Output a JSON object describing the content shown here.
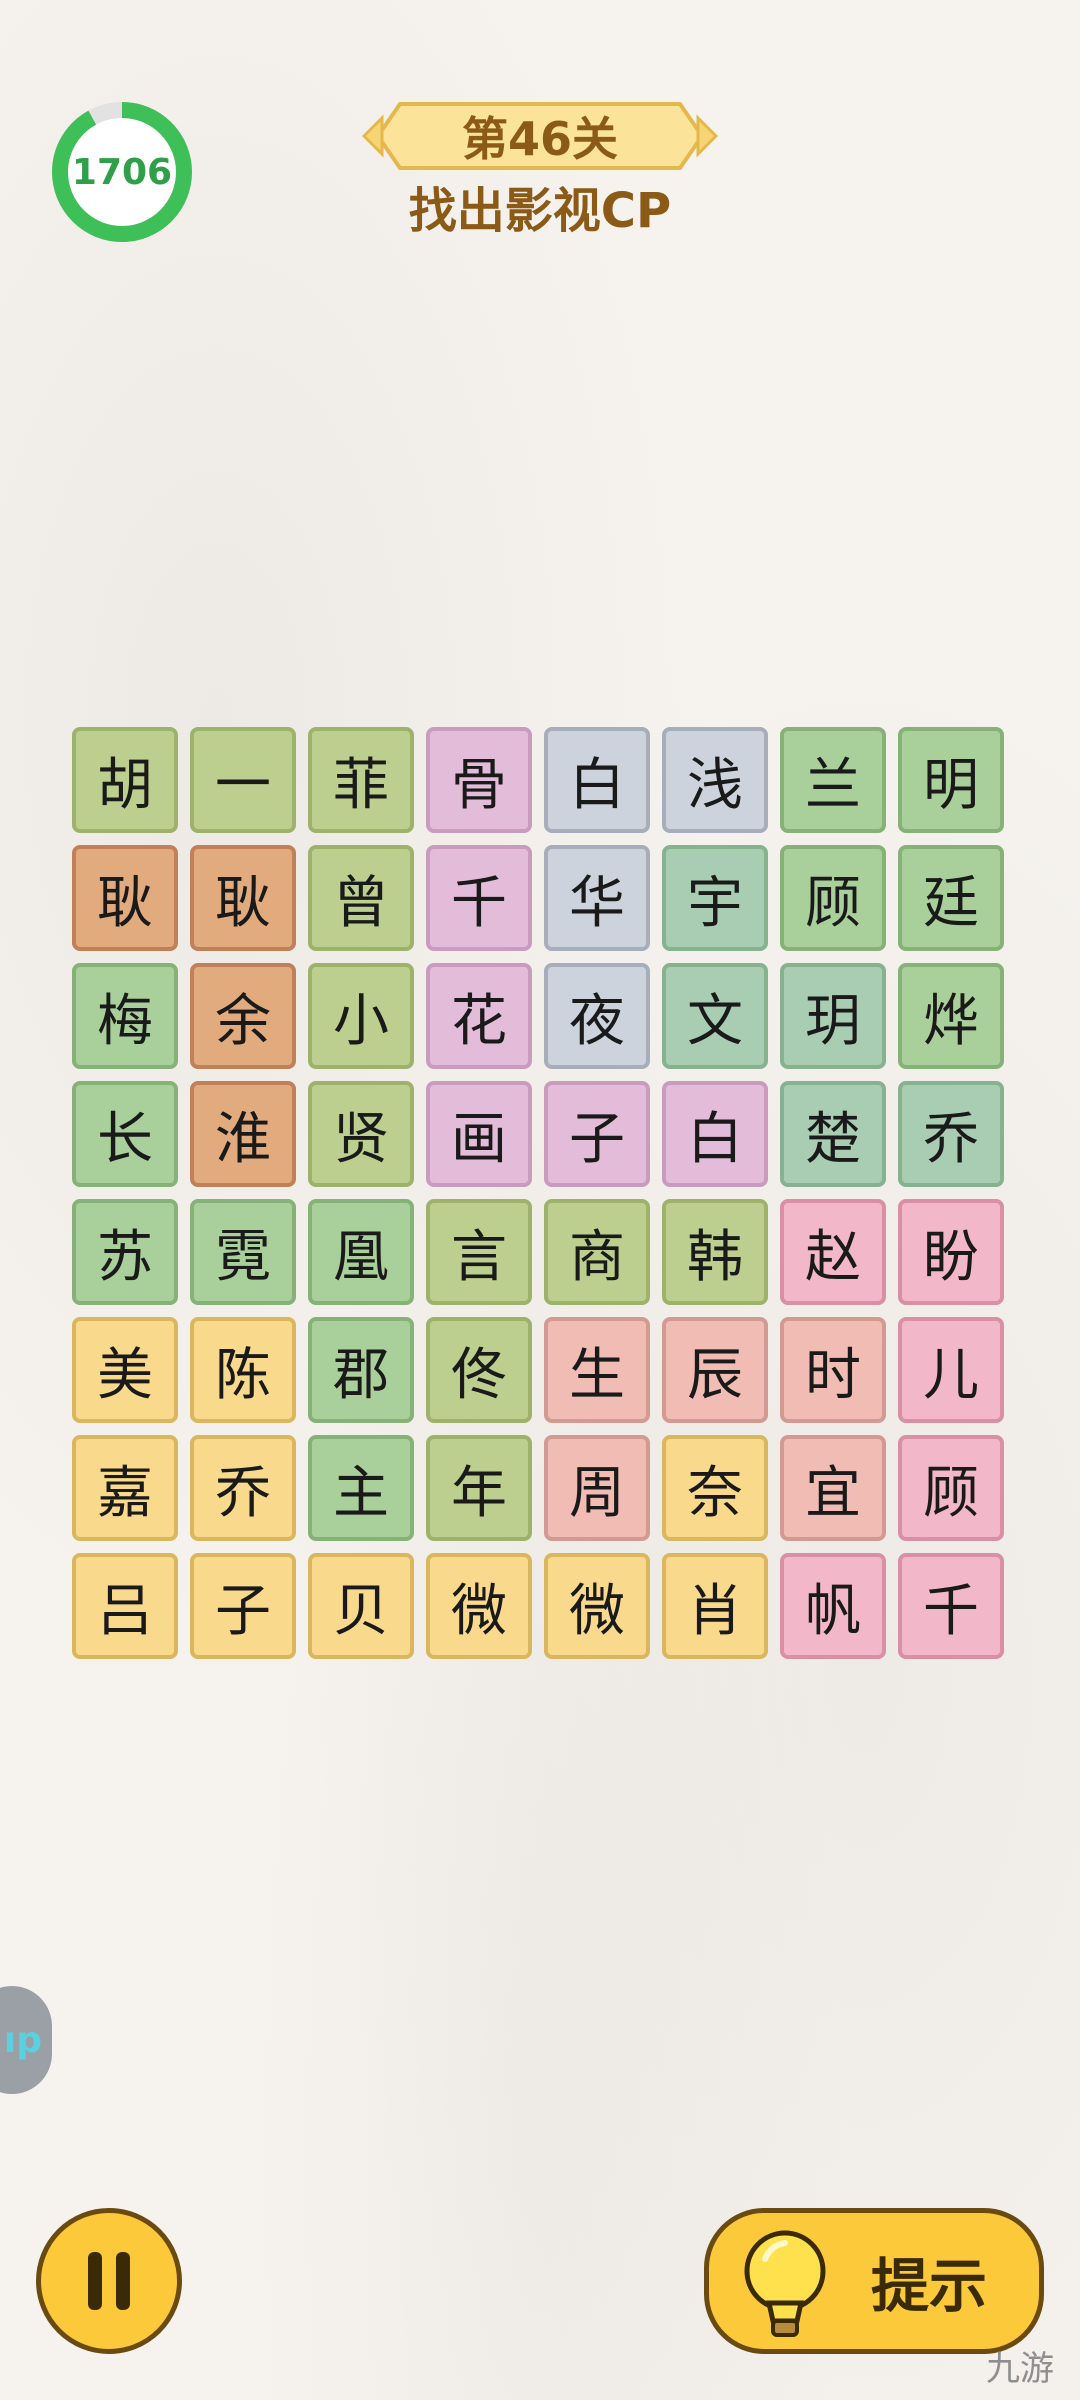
{
  "timer": {
    "value": "1706",
    "progress": 0.92,
    "color": "#2f9f4a"
  },
  "level": {
    "title": "第46关",
    "subtitle": "找出影视CP"
  },
  "grid": {
    "rows": [
      [
        {
          "t": "胡",
          "c": "g"
        },
        {
          "t": "一",
          "c": "g"
        },
        {
          "t": "菲",
          "c": "g"
        },
        {
          "t": "骨",
          "c": "p"
        },
        {
          "t": "白",
          "c": "b"
        },
        {
          "t": "浅",
          "c": "b"
        },
        {
          "t": "兰",
          "c": "lg"
        },
        {
          "t": "明",
          "c": "lg"
        }
      ],
      [
        {
          "t": "耿",
          "c": "o"
        },
        {
          "t": "耿",
          "c": "o"
        },
        {
          "t": "曾",
          "c": "g"
        },
        {
          "t": "千",
          "c": "p"
        },
        {
          "t": "华",
          "c": "b"
        },
        {
          "t": "宇",
          "c": "t"
        },
        {
          "t": "顾",
          "c": "lg"
        },
        {
          "t": "廷",
          "c": "lg"
        }
      ],
      [
        {
          "t": "梅",
          "c": "lg"
        },
        {
          "t": "余",
          "c": "o"
        },
        {
          "t": "小",
          "c": "g"
        },
        {
          "t": "花",
          "c": "p"
        },
        {
          "t": "夜",
          "c": "b"
        },
        {
          "t": "文",
          "c": "t"
        },
        {
          "t": "玥",
          "c": "t"
        },
        {
          "t": "烨",
          "c": "lg"
        }
      ],
      [
        {
          "t": "长",
          "c": "lg"
        },
        {
          "t": "淮",
          "c": "o"
        },
        {
          "t": "贤",
          "c": "g"
        },
        {
          "t": "画",
          "c": "p"
        },
        {
          "t": "子",
          "c": "p"
        },
        {
          "t": "白",
          "c": "p"
        },
        {
          "t": "楚",
          "c": "t"
        },
        {
          "t": "乔",
          "c": "t"
        }
      ],
      [
        {
          "t": "苏",
          "c": "lg"
        },
        {
          "t": "霓",
          "c": "lg"
        },
        {
          "t": "凰",
          "c": "lg"
        },
        {
          "t": "言",
          "c": "g"
        },
        {
          "t": "商",
          "c": "g"
        },
        {
          "t": "韩",
          "c": "g"
        },
        {
          "t": "赵",
          "c": "pk"
        },
        {
          "t": "盼",
          "c": "pk"
        }
      ],
      [
        {
          "t": "美",
          "c": "y"
        },
        {
          "t": "陈",
          "c": "y"
        },
        {
          "t": "郡",
          "c": "lg"
        },
        {
          "t": "佟",
          "c": "g"
        },
        {
          "t": "生",
          "c": "s"
        },
        {
          "t": "辰",
          "c": "s"
        },
        {
          "t": "时",
          "c": "s"
        },
        {
          "t": "儿",
          "c": "pk"
        }
      ],
      [
        {
          "t": "嘉",
          "c": "y"
        },
        {
          "t": "乔",
          "c": "y"
        },
        {
          "t": "主",
          "c": "lg"
        },
        {
          "t": "年",
          "c": "g"
        },
        {
          "t": "周",
          "c": "s"
        },
        {
          "t": "奈",
          "c": "y"
        },
        {
          "t": "宜",
          "c": "s"
        },
        {
          "t": "顾",
          "c": "pk"
        }
      ],
      [
        {
          "t": "吕",
          "c": "y"
        },
        {
          "t": "子",
          "c": "y"
        },
        {
          "t": "贝",
          "c": "y"
        },
        {
          "t": "微",
          "c": "y"
        },
        {
          "t": "微",
          "c": "y"
        },
        {
          "t": "肖",
          "c": "y"
        },
        {
          "t": "帆",
          "c": "pk"
        },
        {
          "t": "千",
          "c": "pk"
        }
      ]
    ]
  },
  "side_button": {
    "label": "ıp"
  },
  "buttons": {
    "pause_icon": "pause-icon",
    "hint_label": "提示",
    "hint_icon": "lightbulb-icon"
  },
  "watermark": "九游",
  "colors": {
    "accent": "#fbc93a",
    "title_brown": "#8a5a16",
    "background": "#f6f3ef"
  }
}
